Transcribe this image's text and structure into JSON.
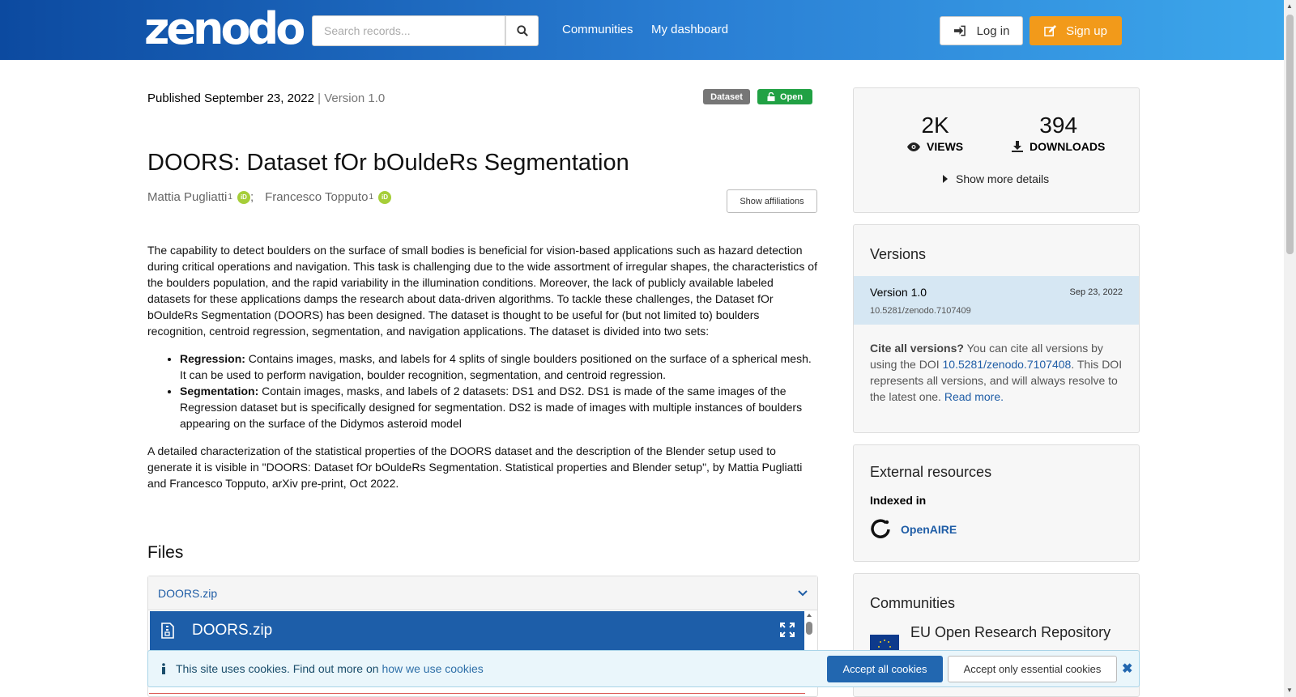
{
  "header": {
    "logo": "zenodo",
    "search_placeholder": "Search records...",
    "nav": [
      "Communities",
      "My dashboard"
    ],
    "login_label": "Log in",
    "signup_label": "Sign up"
  },
  "record": {
    "published": "Published September 23, 2022",
    "version": "| Version 1.0",
    "badge_type": "Dataset",
    "badge_access": "Open",
    "title": "DOORS: Dataset fOr bOuldeRs Segmentation",
    "authors": [
      {
        "name": "Mattia Pugliatti",
        "aff": "1",
        "sep": ";"
      },
      {
        "name": "Francesco Topputo",
        "aff": "1",
        "sep": ""
      }
    ],
    "show_affiliations": "Show affiliations",
    "description_p1": "The capability to detect boulders on the surface of small bodies is beneficial for vision-based applications such as hazard detection during critical operations and navigation. This task is challenging due to the wide assortment of irregular shapes, the characteristics of the boulders population, and the rapid variability in the illumination conditions. Moreover, the lack of publicly available labeled datasets for these applications damps the research about data-driven algorithms. To tackle these challenges, the Dataset fOr bOuldeRs Segmentation (DOORS) has been designed. The dataset is thought to be useful for (but not limited to) boulders recognition, centroid regression, segmentation, and navigation applications. The dataset is divided into two sets:",
    "bullets": [
      {
        "head": "Regression:",
        "text": " Contains images, masks, and labels for 4 splits of single boulders positioned on the surface of a spherical mesh. It can be used to perform navigation, boulder recognition, segmentation, and centroid regression."
      },
      {
        "head": "Segmentation:",
        "text": " Contain images, masks, and labels of 2 datasets: DS1 and DS2. DS1 is made of the same images of the Regression dataset but is specifically designed for segmentation. DS2 is made of images with multiple instances of boulders appearing on the surface of the Didymos asteroid model"
      }
    ],
    "description_p2": "A detailed characterization of the statistical properties of the DOORS dataset and the description of the Blender setup used to generate it is visible in \"DOORS: Dataset fOr bOuldeRs Segmentation. Statistical properties and Blender setup\", by Mattia Pugliatti and Francesco Topputo, arXiv pre-print, Oct 2022."
  },
  "files": {
    "heading": "Files",
    "file_name": "DOORS.zip",
    "preview_name": "DOORS.zip"
  },
  "stats": {
    "views_num": "2K",
    "views_label": "VIEWS",
    "downloads_num": "394",
    "downloads_label": "DOWNLOADS",
    "more_details": "Show more details"
  },
  "versions": {
    "heading": "Versions",
    "items": [
      {
        "label": "Version 1.0",
        "date": "Sep 23, 2022",
        "doi": "10.5281/zenodo.7107409"
      }
    ],
    "cite_bold": "Cite all versions?",
    "cite_text1": " You can cite all versions by using the DOI ",
    "cite_doi": "10.5281/zenodo.7107408",
    "cite_text2": ". This DOI represents all versions, and will always resolve to the latest one. ",
    "read_more": "Read more."
  },
  "external": {
    "heading": "External resources",
    "indexed_in": "Indexed in",
    "openaire": "OpenAIRE"
  },
  "communities": {
    "heading": "Communities",
    "name": "EU Open Research Repository"
  },
  "cookie": {
    "message": "This site uses cookies. Find out more on ",
    "link": "how we use cookies",
    "accept_all": "Accept all cookies",
    "accept_essential": "Accept only essential cookies"
  },
  "colors": {
    "header_start": "#0c4aa0",
    "header_end": "#3da8ec",
    "signup": "#f29a1a",
    "open_badge": "#21a144",
    "link": "#1f5da6"
  }
}
